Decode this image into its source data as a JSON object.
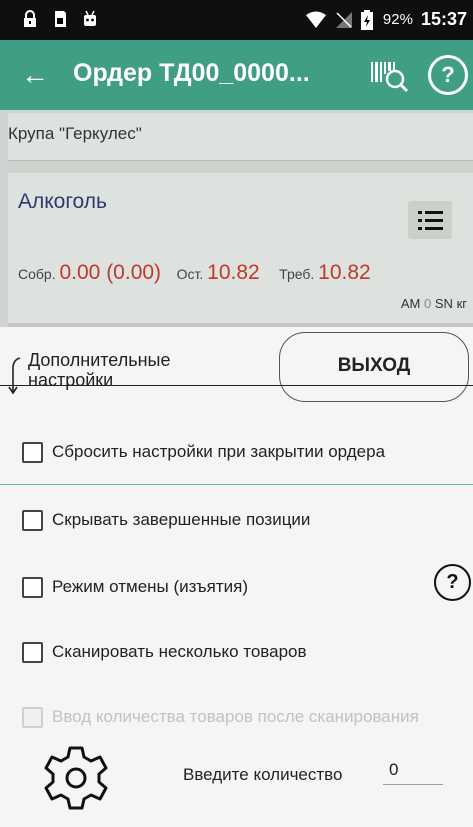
{
  "status_bar": {
    "battery": "92%",
    "time": "15:37",
    "icons": [
      "lock-icon",
      "sd-card-icon",
      "android-icon",
      "wifi-icon",
      "no-signal-icon",
      "battery-icon"
    ]
  },
  "app_bar": {
    "title": "Ордер ТД00_0000...",
    "help": "?",
    "color": "#3f9e84"
  },
  "list": {
    "items": [
      {
        "name": "Крупа \"Геркулес\""
      },
      {
        "name": "Алкоголь",
        "collected_label": "Собр.",
        "collected_value": "0.00 (0.00)",
        "remaining_label": "Ост.",
        "remaining_value": "10.82",
        "required_label": "Треб.",
        "required_value": "10.82",
        "am_label": "АМ",
        "am_value": "0",
        "sn_label": "SN",
        "unit": "кг"
      }
    ]
  },
  "sheet": {
    "advanced_settings_label": "Дополнительные настройки",
    "exit_label": "ВЫХОД",
    "options": [
      {
        "label": "Сбросить настройки при закрытии ордера",
        "checked": false,
        "enabled": true
      },
      {
        "label": "Скрывать завершенные позиции",
        "checked": false,
        "enabled": true
      },
      {
        "label": "Режим отмены (изъятия)",
        "checked": false,
        "enabled": true
      },
      {
        "label": "Сканировать несколько товаров",
        "checked": false,
        "enabled": true
      },
      {
        "label": "Ввод количества товаров после сканирования",
        "checked": false,
        "enabled": false
      }
    ],
    "help": "?",
    "quantity_label": "Введите количество",
    "quantity_value": "0"
  }
}
